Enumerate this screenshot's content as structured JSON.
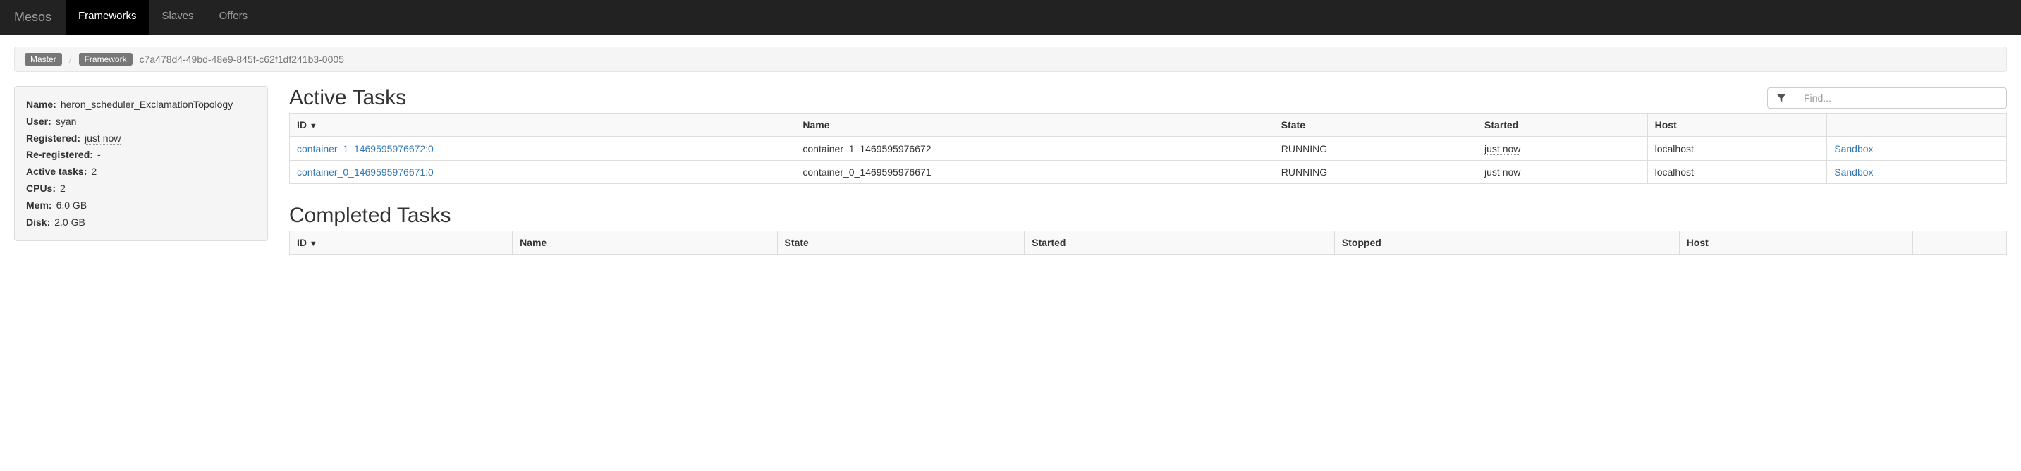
{
  "nav": {
    "brand": "Mesos",
    "items": [
      {
        "label": "Frameworks",
        "active": true
      },
      {
        "label": "Slaves",
        "active": false
      },
      {
        "label": "Offers",
        "active": false
      }
    ]
  },
  "breadcrumb": {
    "master": "Master",
    "framework": "Framework",
    "id": "c7a478d4-49bd-48e9-845f-c62f1df241b3-0005"
  },
  "panel": {
    "name_label": "Name",
    "name": "heron_scheduler_ExclamationTopology",
    "user_label": "User",
    "user": "syan",
    "registered_label": "Registered",
    "registered": "just now",
    "reregistered_label": "Re-registered",
    "reregistered": "-",
    "active_tasks_label": "Active tasks",
    "active_tasks": "2",
    "cpus_label": "CPUs",
    "cpus": "2",
    "mem_label": "Mem",
    "mem": "6.0 GB",
    "disk_label": "Disk",
    "disk": "2.0 GB"
  },
  "active": {
    "heading": "Active Tasks",
    "filter_placeholder": "Find...",
    "cols": [
      "ID",
      "Name",
      "State",
      "Started",
      "Host",
      ""
    ],
    "sort_indicator": "▼",
    "rows": [
      {
        "id": "container_1_1469595976672:0",
        "name": "container_1_1469595976672",
        "state": "RUNNING",
        "started": "just now",
        "host": "localhost",
        "link": "Sandbox"
      },
      {
        "id": "container_0_1469595976671:0",
        "name": "container_0_1469595976671",
        "state": "RUNNING",
        "started": "just now",
        "host": "localhost",
        "link": "Sandbox"
      }
    ]
  },
  "completed": {
    "heading": "Completed Tasks",
    "cols": [
      "ID",
      "Name",
      "State",
      "Started",
      "Stopped",
      "Host",
      ""
    ],
    "sort_indicator": "▼"
  }
}
